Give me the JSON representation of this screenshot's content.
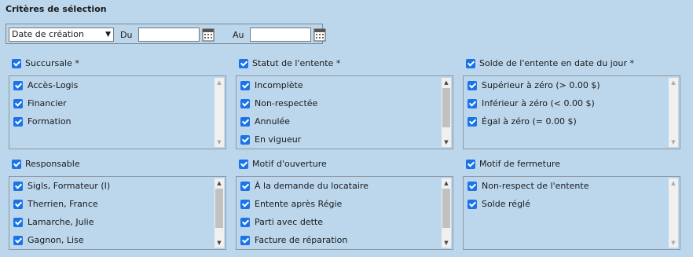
{
  "title": "Critères de sélection",
  "date_filter": {
    "selected": "Date de création",
    "from_label": "Du",
    "to_label": "Au",
    "from_value": "",
    "to_value": ""
  },
  "groups": [
    {
      "label": "Succursale *",
      "items": [
        "Accès-Logis",
        "Financier",
        "Formation"
      ]
    },
    {
      "label": "Statut de l'entente *",
      "items": [
        "Incomplète",
        "Non-respectée",
        "Annulée",
        "En vigueur"
      ]
    },
    {
      "label": "Solde de l'entente en date du jour *",
      "items": [
        "Supérieur à zéro (> 0.00 $)",
        "Inférieur à zéro (< 0.00 $)",
        "Égal à zéro (= 0.00 $)"
      ]
    },
    {
      "label": "Responsable",
      "items": [
        "Sigls, Formateur (I)",
        "Therrien, France",
        "Lamarche, Julie",
        "Gagnon, Lise"
      ]
    },
    {
      "label": "Motif d'ouverture",
      "items": [
        "À la demande du locataire",
        "Entente après Régie",
        "Parti avec dette",
        "Facture de réparation"
      ]
    },
    {
      "label": "Motif de fermeture",
      "items": [
        "Non-respect de l'entente",
        "Solde réglé"
      ]
    }
  ],
  "icons": {
    "calendar": "calendar-icon",
    "check": "checkbox-checked-icon"
  },
  "colors": {
    "background": "#bcd7ec",
    "checkbox": "#1a73e8"
  }
}
